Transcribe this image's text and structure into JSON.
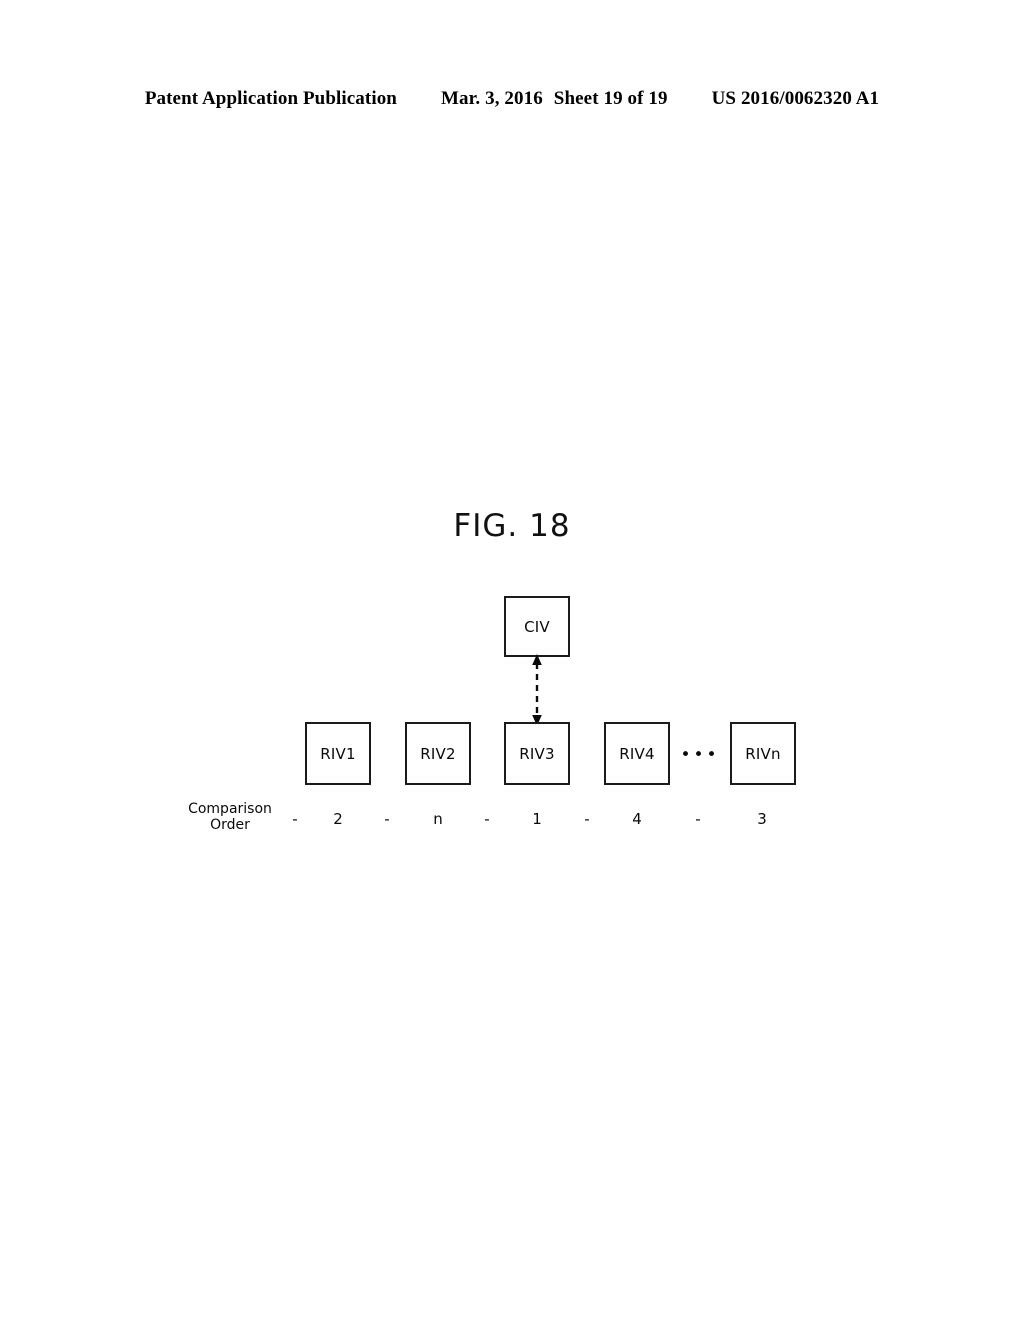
{
  "header": {
    "publication": "Patent Application Publication",
    "date": "Mar. 3, 2016",
    "sheet": "Sheet 19 of 19",
    "publication_number": "US 2016/0062320 A1"
  },
  "figure": {
    "title": "FIG. 18",
    "nodes": {
      "civ": "CIV",
      "riv1": "RIV1",
      "riv2": "RIV2",
      "riv3": "RIV3",
      "riv4": "RIV4",
      "rivn": "RIVn",
      "ellipsis": "•••"
    },
    "connector": {
      "from": "CIV",
      "to": "RIV3",
      "style": "dashed",
      "arrowheads": "both"
    },
    "comparison_order": {
      "label_line1": "Comparison",
      "label_line2": "Order",
      "dash": "-",
      "values": [
        "2",
        "n",
        "1",
        "4",
        "3"
      ]
    }
  },
  "colors": {
    "ink": "#000000",
    "box_border": "#1b1b1b",
    "page_background": "#ffffff"
  }
}
